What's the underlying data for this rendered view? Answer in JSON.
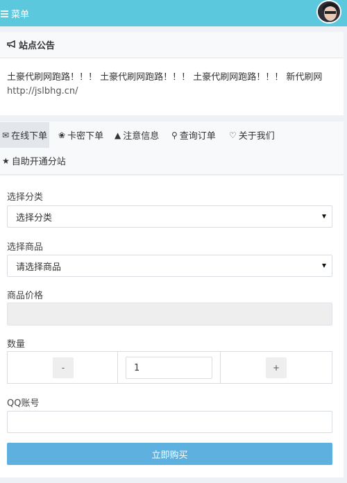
{
  "topbar": {
    "menu_label": "菜单"
  },
  "notice": {
    "title": "站点公告",
    "line1": "土豪代刷网跑路！！！ 土豪代刷网跑路！！！ 土豪代刷网跑路！！！ 新代刷网",
    "url": "http://jslbhg.cn/"
  },
  "tabs": [
    {
      "icon": "✉",
      "label": "在线下单"
    },
    {
      "icon": "❀",
      "label": "卡密下单"
    },
    {
      "icon": "▲",
      "label": "注意信息"
    },
    {
      "icon": "⚲",
      "label": "查询订单"
    },
    {
      "icon": "♡",
      "label": "关于我们"
    },
    {
      "icon": "★",
      "label": "自助开通分站"
    }
  ],
  "form": {
    "category_label": "选择分类",
    "category_value": "选择分类",
    "product_label": "选择商品",
    "product_value": "请选择商品",
    "price_label": "商品价格",
    "price_value": "",
    "qty_label": "数量",
    "qty_minus": "-",
    "qty_value": "1",
    "qty_plus": "+",
    "qq_label": "QQ账号",
    "qq_value": "",
    "buy_label": "立即购买"
  },
  "colors": {
    "topbar": "#5bc8de",
    "buy_button": "#5eb0df"
  }
}
